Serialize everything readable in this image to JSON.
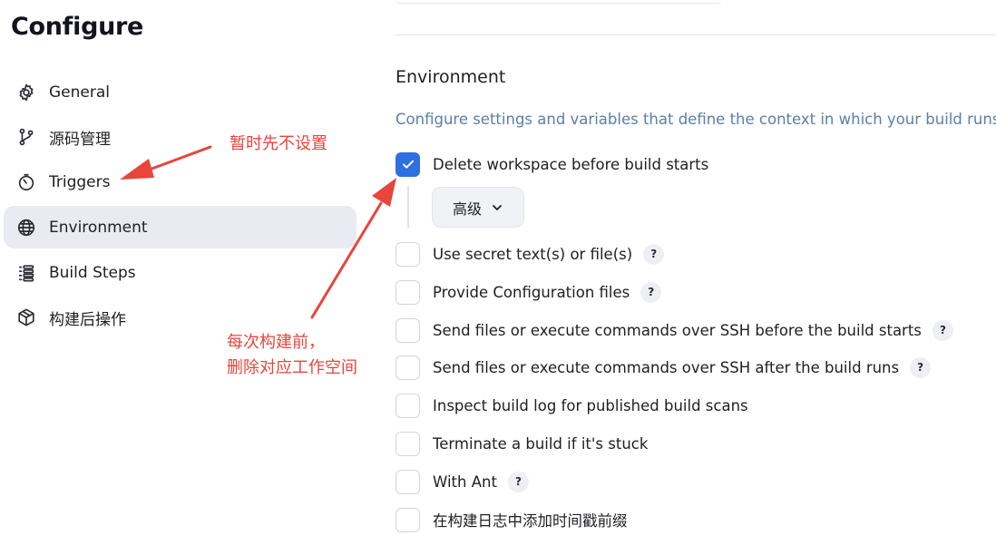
{
  "page_title": "Configure",
  "nav": [
    {
      "label": "General",
      "icon": "gear-icon",
      "active": false
    },
    {
      "label": "源码管理",
      "icon": "source-branch-icon",
      "active": false
    },
    {
      "label": "Triggers",
      "icon": "timer-icon",
      "active": false
    },
    {
      "label": "Environment",
      "icon": "globe-icon",
      "active": true
    },
    {
      "label": "Build Steps",
      "icon": "list-steps-icon",
      "active": false
    },
    {
      "label": "构建后操作",
      "icon": "package-icon",
      "active": false
    }
  ],
  "section": {
    "title": "Environment",
    "description": "Configure settings and variables that define the context in which your build runs."
  },
  "options": [
    {
      "label": "Delete workspace before build starts",
      "checked": true,
      "help": false
    },
    {
      "label": "Use secret text(s) or file(s)",
      "checked": false,
      "help": true
    },
    {
      "label": "Provide Configuration files",
      "checked": false,
      "help": true
    },
    {
      "label": "Send files or execute commands over SSH before the build starts",
      "checked": false,
      "help": true
    },
    {
      "label": "Send files or execute commands over SSH after the build runs",
      "checked": false,
      "help": true
    },
    {
      "label": "Inspect build log for published build scans",
      "checked": false,
      "help": false
    },
    {
      "label": "Terminate a build if it's stuck",
      "checked": false,
      "help": false
    },
    {
      "label": "With Ant",
      "checked": false,
      "help": true
    },
    {
      "label": "在构建日志中添加时间戳前缀",
      "checked": false,
      "help": false
    }
  ],
  "advanced_button": "高级",
  "help_glyph": "?",
  "annotations": {
    "triggers_note": "暂时先不设置",
    "delete_note_line1": "每次构建前，",
    "delete_note_line2": "删除对应工作空间"
  },
  "colors": {
    "accent": "#2f6fdf",
    "annotation": "#e8453c",
    "active_nav_bg": "#e9eaf2",
    "description_text": "#5a7fa8"
  }
}
